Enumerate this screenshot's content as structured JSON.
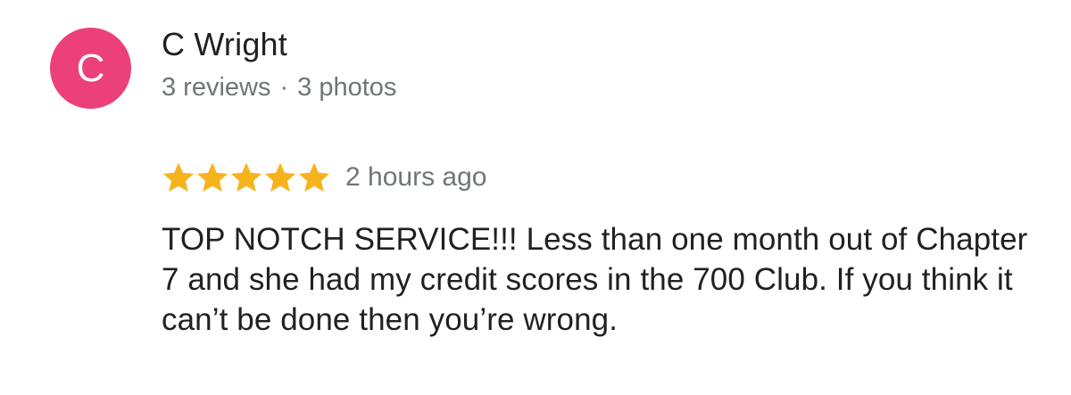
{
  "reviewer": {
    "initial": "C",
    "name": "C Wright",
    "reviews_count": "3 reviews",
    "separator": "·",
    "photos_count": "3 photos",
    "avatar_color": "#ec407a"
  },
  "review": {
    "rating": 5,
    "max_rating": 5,
    "star_color": "#f6b31c",
    "time_ago": "2 hours ago",
    "text": "TOP NOTCH SERVICE!!! Less than one month out of Chapter 7 and she had my credit scores in the 700 Club. If you think it can’t be done then you’re wrong."
  }
}
